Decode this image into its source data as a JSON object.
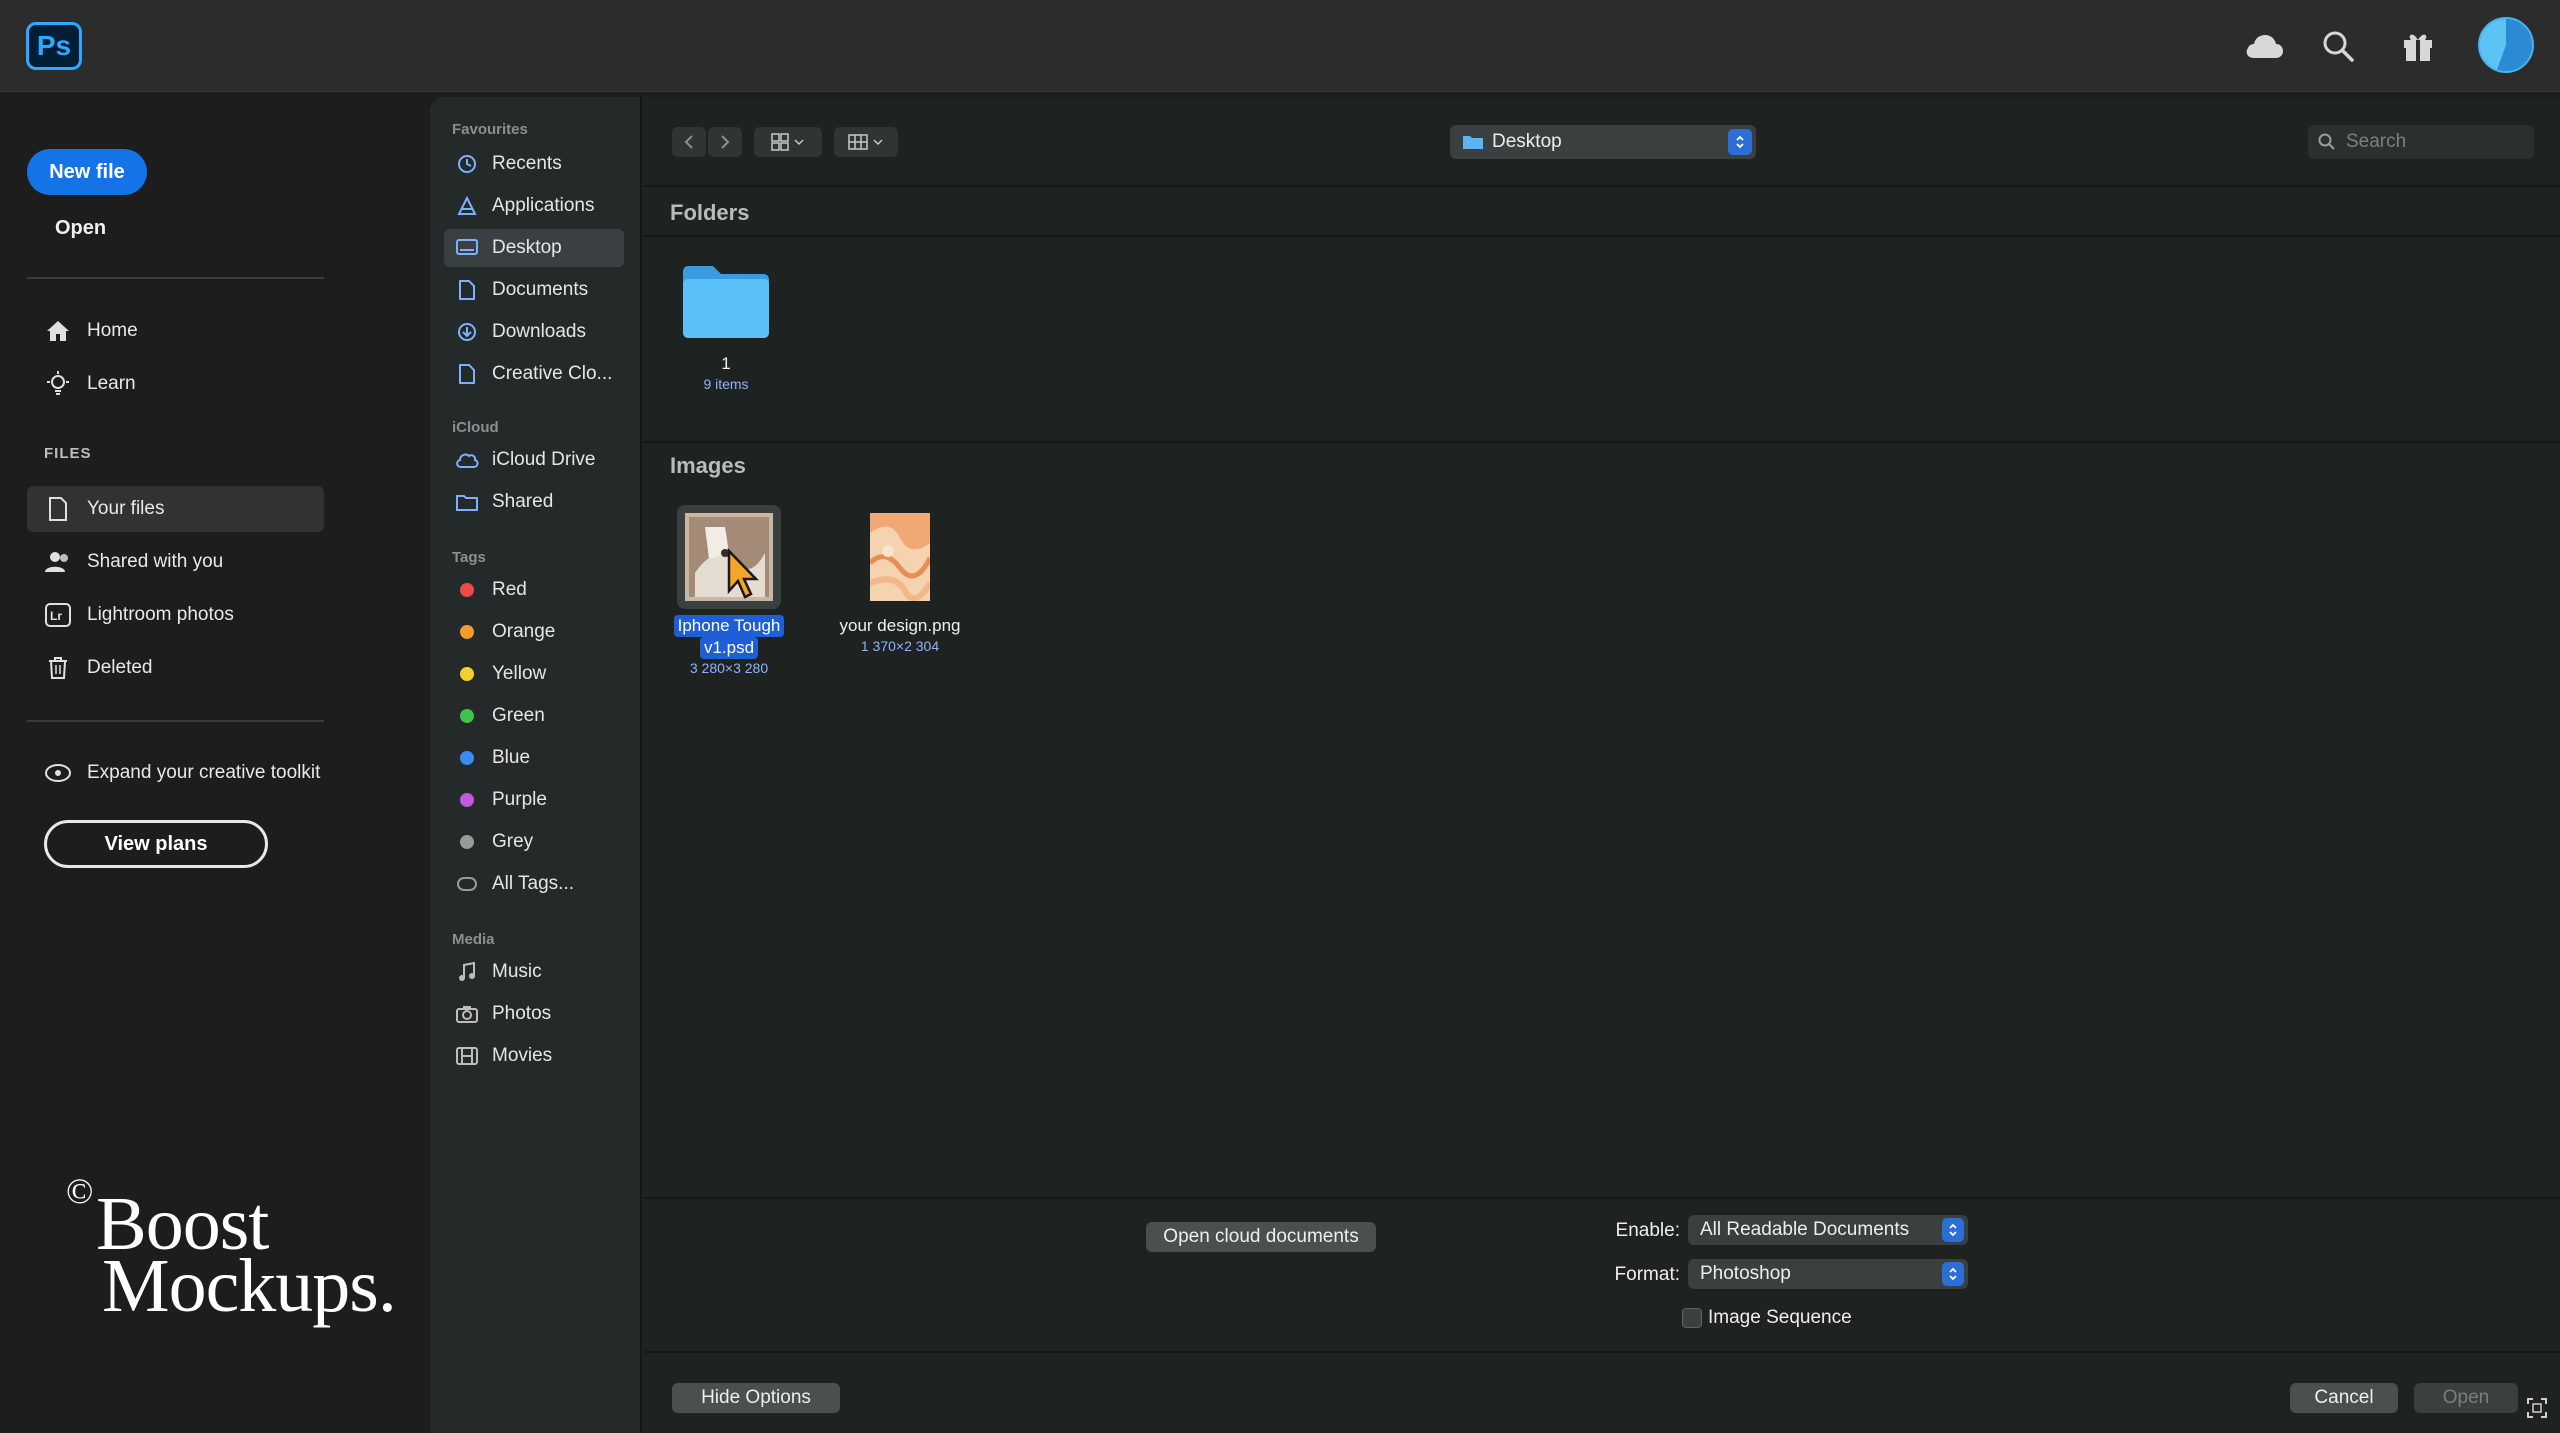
{
  "app": {
    "logo_text": "Ps",
    "accent_color": "#1473e6",
    "top_icons": [
      "cloud-icon",
      "search-icon",
      "gift-icon"
    ]
  },
  "app_sidebar": {
    "new_file_label": "New file",
    "open_label": "Open",
    "nav": [
      {
        "label": "Home",
        "icon": "home-icon"
      },
      {
        "label": "Learn",
        "icon": "lightbulb-icon"
      }
    ],
    "files_heading": "FILES",
    "files": [
      {
        "label": "Your files",
        "icon": "document-icon",
        "active": true
      },
      {
        "label": "Shared with you",
        "icon": "people-icon"
      },
      {
        "label": "Lightroom photos",
        "icon": "lightroom-icon"
      },
      {
        "label": "Deleted",
        "icon": "trash-icon"
      }
    ],
    "expand_label": "Expand your creative toolkit",
    "view_plans_label": "View plans"
  },
  "watermark": {
    "copyright": "©",
    "line1": "Boost",
    "line2": "Mockups."
  },
  "dialog": {
    "sidebar": {
      "favourites_heading": "Favourites",
      "favourites": [
        {
          "label": "Recents",
          "icon": "clock-icon"
        },
        {
          "label": "Applications",
          "icon": "applications-icon"
        },
        {
          "label": "Desktop",
          "icon": "desktop-icon",
          "active": true
        },
        {
          "label": "Documents",
          "icon": "document-icon"
        },
        {
          "label": "Downloads",
          "icon": "download-icon"
        },
        {
          "label": "Creative Clo...",
          "icon": "document-icon"
        }
      ],
      "icloud_heading": "iCloud",
      "icloud": [
        {
          "label": "iCloud Drive",
          "icon": "cloud-icon"
        },
        {
          "label": "Shared",
          "icon": "shared-folder-icon"
        }
      ],
      "tags_heading": "Tags",
      "tags": [
        {
          "label": "Red",
          "color": "#ef4a4a"
        },
        {
          "label": "Orange",
          "color": "#f59b2c"
        },
        {
          "label": "Yellow",
          "color": "#f2cf2f"
        },
        {
          "label": "Green",
          "color": "#3fc34a"
        },
        {
          "label": "Blue",
          "color": "#3b8cf0"
        },
        {
          "label": "Purple",
          "color": "#c05ae0"
        },
        {
          "label": "Grey",
          "color": "#9a9a9a"
        },
        {
          "label": "All Tags...",
          "color": ""
        }
      ],
      "media_heading": "Media",
      "media": [
        {
          "label": "Music",
          "icon": "music-icon"
        },
        {
          "label": "Photos",
          "icon": "camera-icon"
        },
        {
          "label": "Movies",
          "icon": "film-icon"
        }
      ]
    },
    "location": "Desktop",
    "search_placeholder": "Search",
    "folders_heading": "Folders",
    "folders": [
      {
        "name": "1",
        "meta": "9 items"
      }
    ],
    "images_heading": "Images",
    "images": [
      {
        "name_line1": "Iphone Tough",
        "name_line2": "v1.psd",
        "meta": "3 280×3 280",
        "selected": true
      },
      {
        "name_line1": "your design.png",
        "name_line2": "",
        "meta": "1 370×2 304",
        "selected": false
      }
    ],
    "open_cloud_label": "Open cloud documents",
    "enable_label": "Enable:",
    "enable_value": "All Readable Documents",
    "format_label": "Format:",
    "format_value": "Photoshop",
    "image_sequence_label": "Image Sequence",
    "hide_options_label": "Hide Options",
    "cancel_label": "Cancel",
    "open_label": "Open"
  }
}
